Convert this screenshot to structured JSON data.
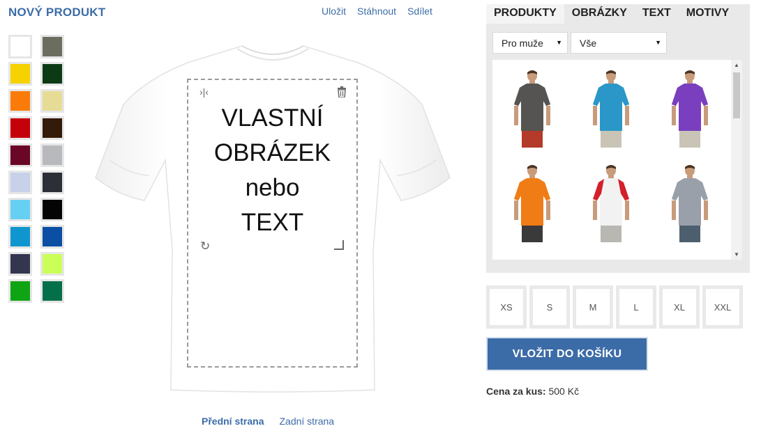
{
  "header": {
    "title": "NOVÝ PRODUKT"
  },
  "top_links": {
    "save": "Uložit",
    "download": "Stáhnout",
    "share": "Sdílet"
  },
  "colors": {
    "accent": "#3c6ca8",
    "swatches": [
      "#ffffff",
      "#6b6d5e",
      "#f6d200",
      "#0c3a14",
      "#fb7b08",
      "#e6dc96",
      "#c4000b",
      "#341a08",
      "#6a0726",
      "#b8b9bd",
      "#c8d1ea",
      "#2c2f35",
      "#66d0f2",
      "#040404",
      "#1096ce",
      "#0a4fa4",
      "#343650",
      "#caff58",
      "#0fa413",
      "#04704a"
    ]
  },
  "canvas": {
    "print_text": [
      "VLASTNÍ",
      "OBRÁZEK",
      "nebo",
      "TEXT"
    ],
    "controls": {
      "mirror": "mirror-icon",
      "trash": "trash-icon",
      "rotate": "rotate-icon",
      "resize": "resize-icon"
    }
  },
  "side_tabs": {
    "front": "Přední strana",
    "back": "Zadní strana"
  },
  "panel": {
    "tabs": [
      "PRODUKTY",
      "OBRÁZKY",
      "TEXT",
      "MOTIVY"
    ],
    "filter_gender": "Pro muže",
    "filter_type": "Vše",
    "products": [
      {
        "shirt": "#555452",
        "sleeve": "#555452",
        "pants": "#b43a2a"
      },
      {
        "shirt": "#2a97c8",
        "sleeve": "#2a97c8",
        "pants": "#c9c4b5"
      },
      {
        "shirt": "#7a3fbf",
        "sleeve": "#7a3fbf",
        "pants": "#c9c4b5"
      },
      {
        "shirt": "#f07c16",
        "sleeve": "#f07c16",
        "pants": "#3a3a3a"
      },
      {
        "shirt": "#f2f2f2",
        "sleeve": "#d3202a",
        "pants": "#b9b7b1"
      },
      {
        "shirt": "#9aa0aa",
        "sleeve": "#9aa0aa",
        "pants": "#4d5f6e"
      }
    ]
  },
  "sizes": [
    "XS",
    "S",
    "M",
    "L",
    "XL",
    "XXL"
  ],
  "cart": {
    "button_label": "VLOŽIT DO KOŠÍKU"
  },
  "price": {
    "label": "Cena za kus:",
    "value": "500 Kč"
  }
}
